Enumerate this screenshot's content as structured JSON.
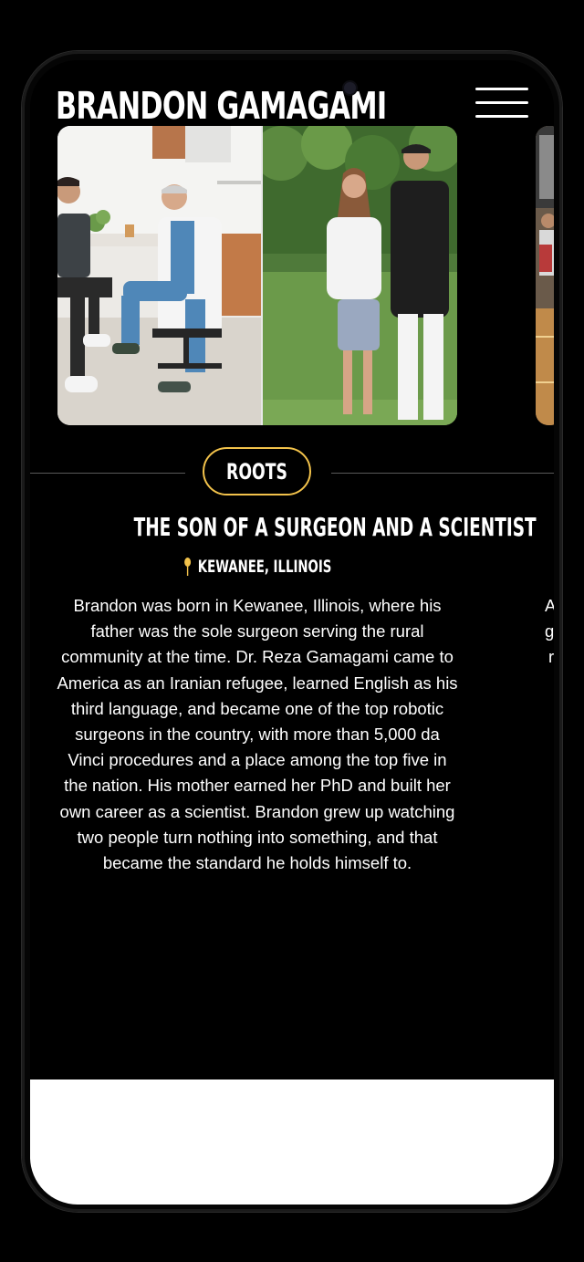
{
  "header": {
    "brand": "BRANDON GAMAGAMI",
    "menu_label": "Menu"
  },
  "chapter": {
    "pill": "ROOTS",
    "title": "THE SON OF A SURGEON AND A SCIENTIST",
    "location": "KEWANEE, ILLINOIS",
    "body": "Brandon was born in Kewanee, Illinois, where his father was the sole surgeon serving the rural community at the time. Dr. Reza Gamagami came to America as an Iranian refugee, learned English as his third language, and became one of the top robotic surgeons in the country, with more than 5,000 da Vinci procedures and a place among the top five in the nation. His mother earned her PhD and built her own career as a scientist. Brandon grew up watching two people turn nothing into something, and that became the standard he holds himself to."
  },
  "next_chapter_peek": [
    "A",
    "g",
    "r"
  ],
  "colors": {
    "accent": "#f2c24b",
    "background": "#000000",
    "text": "#ffffff"
  },
  "icons": {
    "menu": "hamburger-icon",
    "location": "map-pin-icon"
  }
}
